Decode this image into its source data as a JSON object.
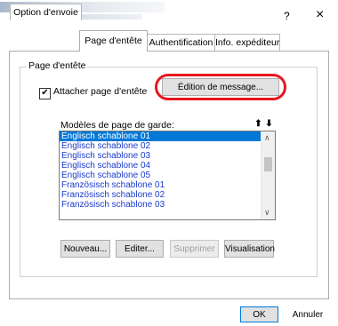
{
  "tabs": [
    {
      "label": "Option d'envoie"
    },
    {
      "label": "Page d'entête"
    },
    {
      "label": "Authentification"
    },
    {
      "label": "Info. expéditeur"
    }
  ],
  "window": {
    "help_label": "?",
    "close_label": "×"
  },
  "group": {
    "title": "Page d'entête"
  },
  "attach": {
    "checkbox_mark": "✔",
    "label": "Attacher page d'entête",
    "checked": true
  },
  "edit_message_button": "Édition de message...",
  "templates": {
    "label": "Modèles de page de garde:",
    "move_up_icon": "⬆",
    "move_down_icon": "⬇",
    "items": [
      "Englisch schablone 01",
      "Englisch schablone 02",
      "Englisch schablone 03",
      "Englisch schablone 04",
      "Englisch schablone 05",
      "Französisch schablone 01",
      "Französisch schablone 02",
      "Französisch schablone 03"
    ],
    "selected_index": 0,
    "scroll_up_icon": "∧",
    "scroll_down_icon": "∨"
  },
  "buttons": {
    "new": "Nouveau...",
    "edit": "Editer...",
    "delete": "Supprimer",
    "preview": "Visualisation"
  },
  "footer": {
    "ok": "OK",
    "cancel": "Annuler"
  }
}
